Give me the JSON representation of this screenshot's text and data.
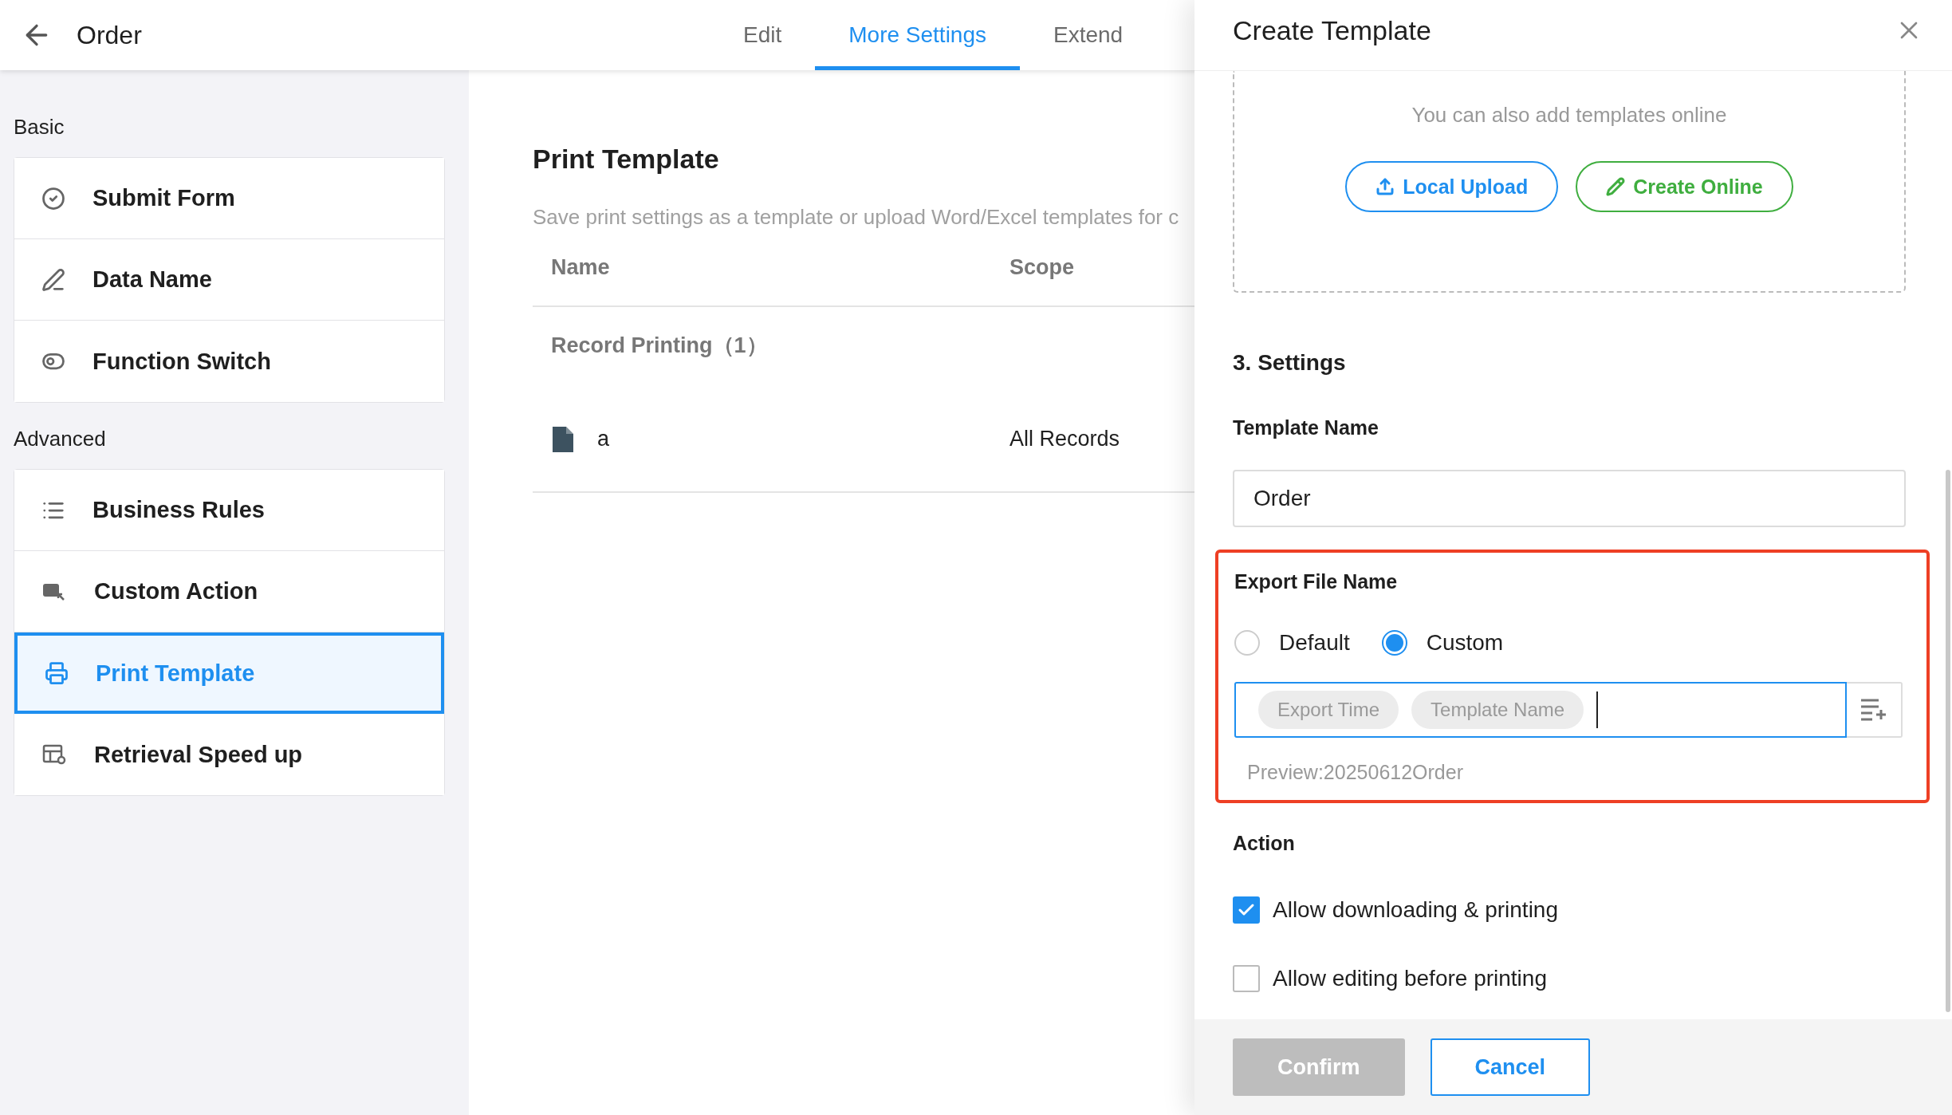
{
  "header": {
    "title": "Order",
    "tabs": [
      {
        "label": "Edit",
        "selected": false
      },
      {
        "label": "More Settings",
        "selected": true
      },
      {
        "label": "Extend",
        "selected": false
      }
    ]
  },
  "sidebar": {
    "groups": [
      {
        "title": "Basic",
        "items": [
          {
            "label": "Submit Form",
            "kind": "check",
            "selected": false
          },
          {
            "label": "Data Name",
            "kind": "pen",
            "selected": false
          },
          {
            "label": "Function Switch",
            "kind": "toggle",
            "selected": false
          }
        ]
      },
      {
        "title": "Advanced",
        "items": [
          {
            "label": "Business Rules",
            "kind": "list",
            "selected": false
          },
          {
            "label": "Custom Action",
            "kind": "action",
            "selected": false
          },
          {
            "label": "Print Template",
            "kind": "printer",
            "selected": true
          },
          {
            "label": "Retrieval Speed up",
            "kind": "table",
            "selected": false
          }
        ]
      }
    ]
  },
  "main": {
    "title": "Print Template",
    "description": "Save print settings as a template or upload Word/Excel templates for c",
    "table": {
      "columns": [
        "Name",
        "Scope"
      ],
      "group": "Record Printing（1）",
      "rows": [
        {
          "name": "a",
          "scope": "All Records"
        }
      ]
    }
  },
  "drawer": {
    "title": "Create Template",
    "upload_hint": "You can also add templates online",
    "upload_buttons": [
      {
        "label": "Local Upload",
        "kind": "upload"
      },
      {
        "label": "Create Online",
        "kind": "online"
      }
    ],
    "settings_title": "3. Settings",
    "template_name": {
      "label": "Template Name",
      "value": "Order"
    },
    "export_file_name": {
      "label": "Export File Name",
      "highlighted": true,
      "options": [
        {
          "label": "Default",
          "selected": false
        },
        {
          "label": "Custom",
          "selected": true
        }
      ],
      "tags": [
        "Export Time",
        "Template Name"
      ],
      "preview": "Preview:20250612Order"
    },
    "action": {
      "label": "Action",
      "options": [
        {
          "label": "Allow downloading & printing",
          "checked": true
        },
        {
          "label": "Allow editing before printing",
          "checked": false
        }
      ]
    },
    "buttons": [
      {
        "label": "Confirm",
        "disabled": true
      },
      {
        "label": "Cancel",
        "disabled": false
      }
    ]
  }
}
